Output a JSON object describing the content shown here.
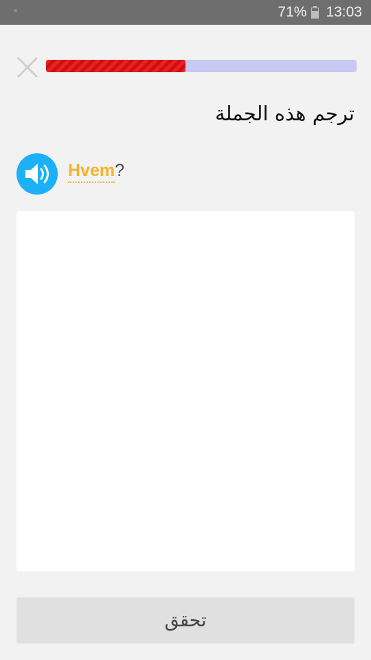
{
  "status_bar": {
    "battery_percent": "71%",
    "battery_level": 0.71,
    "time": "13:03"
  },
  "lesson": {
    "progress": 0.45,
    "progress_color": "#f21d1d",
    "track_color": "#c8c8f2",
    "prompt": "ترجم هذه الجملة",
    "sentence_word": "Hvem",
    "sentence_punct": "?",
    "answer_value": "",
    "check_label": "تحقق"
  },
  "icons": {
    "close": "close-icon",
    "audio": "speaker-icon",
    "battery": "battery-icon"
  },
  "colors": {
    "audio_button": "#1cb0f6",
    "highlight_word": "#f5b32a"
  }
}
